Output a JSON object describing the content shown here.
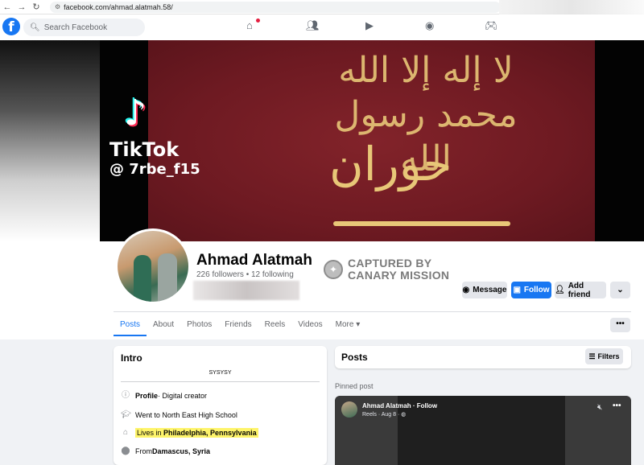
{
  "browser": {
    "url": "facebook.com/ahmad.alatmah.58/",
    "back_icon": "←",
    "forward_icon": "→",
    "reload_icon": "↻"
  },
  "fb_nav": {
    "logo": "f",
    "search_placeholder": "Search Facebook"
  },
  "cover": {
    "watermark_app": "TikTok",
    "watermark_handle": "@ 7rbe_f15",
    "flag_text_top": "لا إله إلا الله محمد رسول الله",
    "flag_text_main": "حوران"
  },
  "profile": {
    "name": "Ahmad Alatmah",
    "followers": "226 followers • 12 following",
    "watermark_line1": "CAPTURED BY",
    "watermark_line2": "CANARY MISSION"
  },
  "actions": {
    "message": "Message",
    "follow": "Follow",
    "add_friend": "Add friend",
    "chevron": "⌄"
  },
  "tabs": {
    "posts": "Posts",
    "about": "About",
    "photos": "Photos",
    "friends": "Friends",
    "reels": "Reels",
    "videos": "Videos",
    "more": "More ▾",
    "overflow": "•••"
  },
  "intro": {
    "title": "Intro",
    "bio": "SYSYSY",
    "profile_label": "Profile",
    "profile_value": " · Digital creator",
    "school": "Went to North East High School",
    "lives_prefix": "Lives in ",
    "lives_place": "Philadelphia, Pennsylvania",
    "from_prefix": "From ",
    "from_place": "Damascus, Syria"
  },
  "posts": {
    "title": "Posts",
    "filters": "Filters",
    "pinned": "Pinned post",
    "reel_title": "Ahmad Alatmah · Follow",
    "reel_sub": "Reels · Aug 8 · ",
    "reel_more": "•••"
  }
}
